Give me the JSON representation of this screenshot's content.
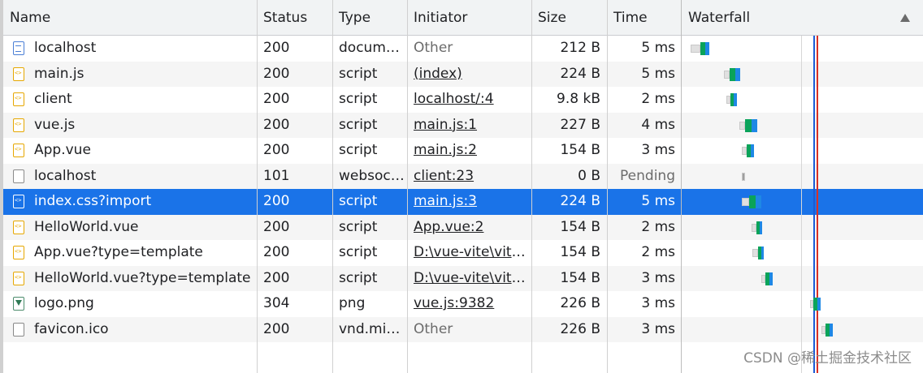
{
  "columns": {
    "name": "Name",
    "status": "Status",
    "type": "Type",
    "initiator": "Initiator",
    "size": "Size",
    "time": "Time",
    "waterfall": "Waterfall"
  },
  "rows": [
    {
      "name": "localhost",
      "status": "200",
      "type": "docume…",
      "initiator": "Other",
      "size": "212 B",
      "time": "5 ms",
      "icon": "document-icon"
    },
    {
      "name": "main.js",
      "status": "200",
      "type": "script",
      "initiator": "(index)",
      "size": "224 B",
      "time": "5 ms",
      "icon": "script-icon"
    },
    {
      "name": "client",
      "status": "200",
      "type": "script",
      "initiator": "localhost/:4",
      "size": "9.8 kB",
      "time": "2 ms",
      "icon": "script-icon"
    },
    {
      "name": "vue.js",
      "status": "200",
      "type": "script",
      "initiator": "main.js:1",
      "size": "227 B",
      "time": "4 ms",
      "icon": "script-icon"
    },
    {
      "name": "App.vue",
      "status": "200",
      "type": "script",
      "initiator": "main.js:2",
      "size": "154 B",
      "time": "3 ms",
      "icon": "script-icon"
    },
    {
      "name": "localhost",
      "status": "101",
      "type": "websoc…",
      "initiator": "client:23",
      "size": "0 B",
      "time": "Pending",
      "icon": "websocket-icon"
    },
    {
      "name": "index.css?import",
      "status": "200",
      "type": "script",
      "initiator": "main.js:3",
      "size": "224 B",
      "time": "5 ms",
      "icon": "script-icon"
    },
    {
      "name": "HelloWorld.vue",
      "status": "200",
      "type": "script",
      "initiator": "App.vue:2",
      "size": "154 B",
      "time": "2 ms",
      "icon": "script-icon"
    },
    {
      "name": "App.vue?type=template",
      "status": "200",
      "type": "script",
      "initiator": "D:\\vue-vite\\vite…",
      "size": "154 B",
      "time": "2 ms",
      "icon": "script-icon"
    },
    {
      "name": "HelloWorld.vue?type=template",
      "status": "200",
      "type": "script",
      "initiator": "D:\\vue-vite\\vite…",
      "size": "154 B",
      "time": "3 ms",
      "icon": "script-icon"
    },
    {
      "name": "logo.png",
      "status": "304",
      "type": "png",
      "initiator": "vue.js:9382",
      "size": "226 B",
      "time": "3 ms",
      "icon": "image-icon"
    },
    {
      "name": "favicon.ico",
      "status": "200",
      "type": "vnd.mic…",
      "initiator": "Other",
      "size": "226 B",
      "time": "3 ms",
      "icon": "file-icon"
    }
  ],
  "selected_row": 6,
  "watermark": "CSDN @稀土掘金技术社区",
  "colors": {
    "selection": "#1a73e8",
    "waiting": "#0aa35a",
    "download": "#1e88e5",
    "domcontentloaded_line": "#1a5bd6",
    "load_line": "#d93025"
  }
}
